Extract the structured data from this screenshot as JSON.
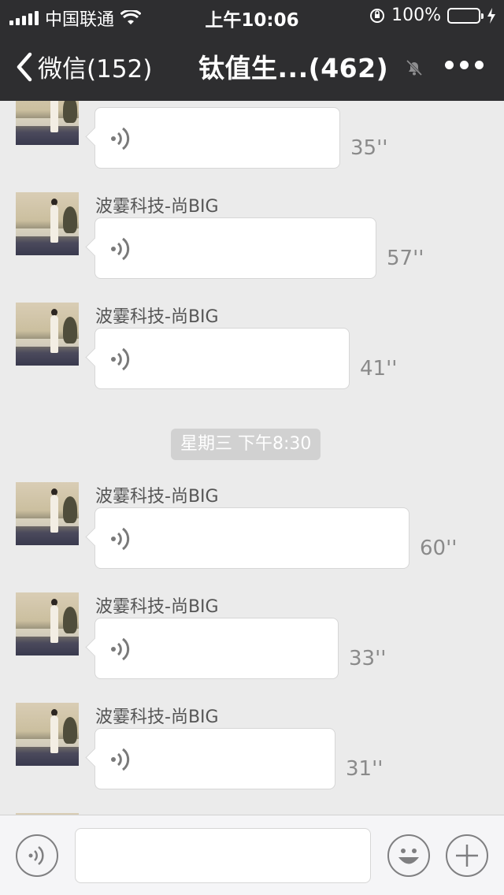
{
  "status_bar": {
    "carrier": "中国联通",
    "time": "上午10:06",
    "battery": "100%",
    "battery_level": 1.0
  },
  "nav": {
    "back_label": "微信(152)",
    "title": "钛值生...(462)"
  },
  "chat": {
    "messages": [
      {
        "sender": "",
        "duration": "35''"
      },
      {
        "sender": "波霎科技-尚BIG",
        "duration": "57''"
      },
      {
        "sender": "波霎科技-尚BIG",
        "duration": "41''"
      },
      {
        "sender": "波霎科技-尚BIG",
        "duration": "60''"
      },
      {
        "sender": "波霎科技-尚BIG",
        "duration": "33''"
      },
      {
        "sender": "波霎科技-尚BIG",
        "duration": "31''"
      }
    ],
    "timestamp": "星期三 下午8:30"
  },
  "input_bar": {
    "voice_icon": "voice-toggle-icon",
    "emoji_icon": "emoji-icon",
    "add_icon": "plus-icon"
  },
  "colors": {
    "header_bg": "#2e2e30",
    "chat_bg": "#ebebeb",
    "battery_green": "#4cd964"
  }
}
